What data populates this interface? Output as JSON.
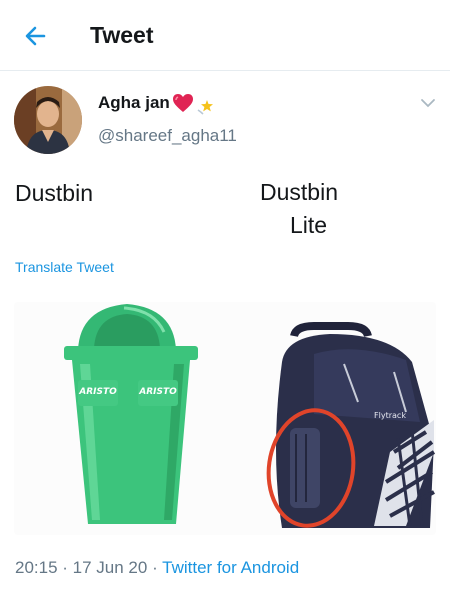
{
  "header": {
    "title": "Tweet"
  },
  "tweet": {
    "display_name": "Agha jan",
    "handle": "@shareef_agha11",
    "text_left": "Dustbin",
    "text_right_line1": "Dustbin",
    "text_right_line2": "Lite",
    "translate_label": "Translate Tweet",
    "media": {
      "dustbin_brand_1": "ARISTO",
      "dustbin_brand_2": "ARISTO",
      "backpack_brand": "Flytrack",
      "dustbin_color": "#3cc47c",
      "backpack_color": "#2b2f4a",
      "circle_color": "#e0442a"
    },
    "time": "20:15",
    "sep1": " · ",
    "date": "17 Jun 20",
    "sep2": " · ",
    "source": "Twitter for Android"
  },
  "colors": {
    "accent": "#1b95e0",
    "secondary_text": "#657786",
    "heart": "#e02454"
  },
  "icons": {
    "back": "arrow-left-icon",
    "more": "chevron-down-icon"
  }
}
